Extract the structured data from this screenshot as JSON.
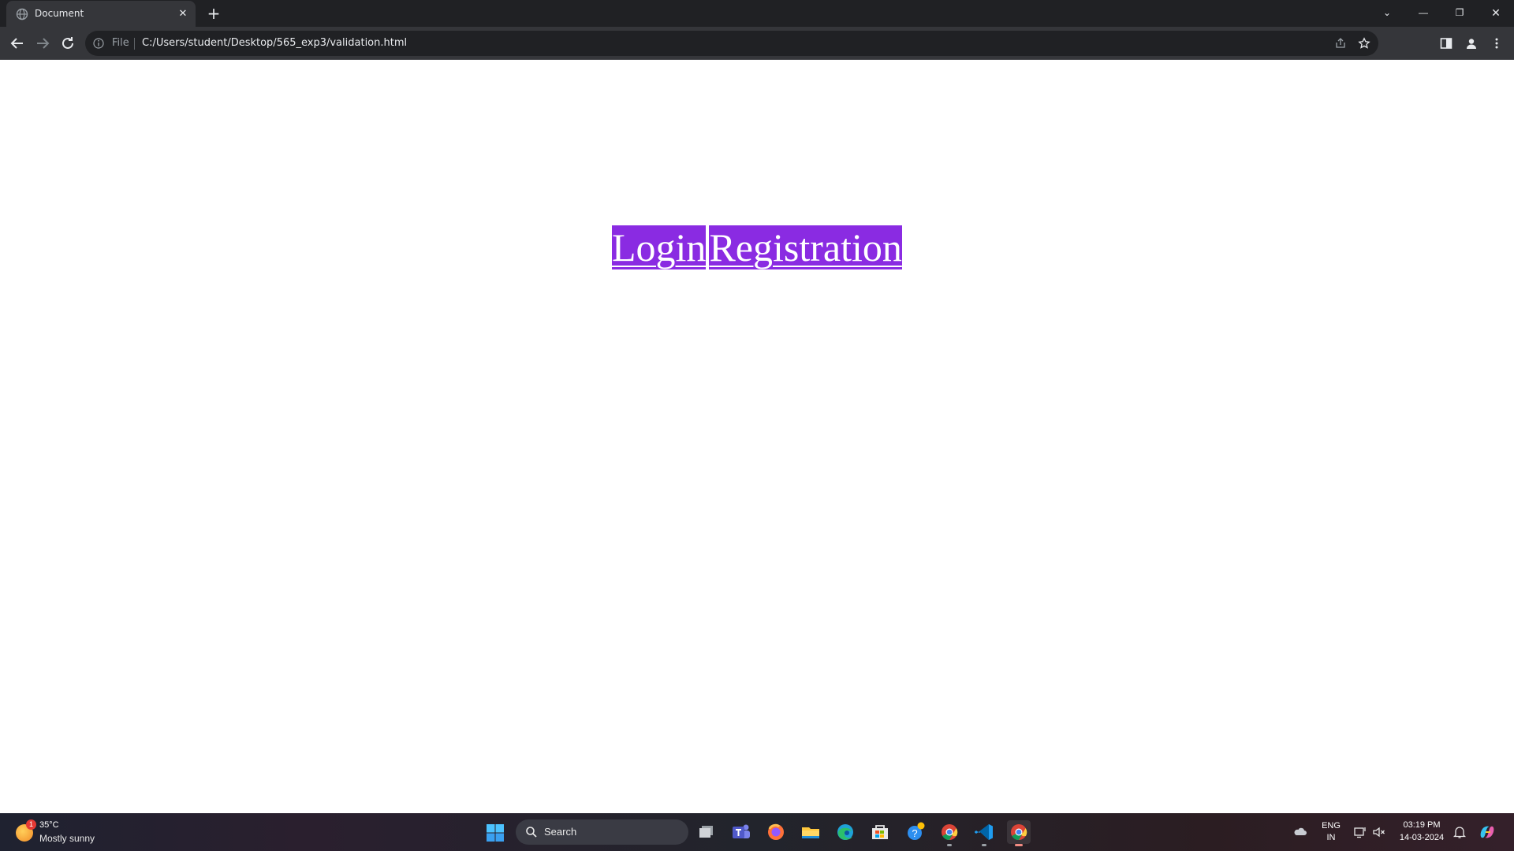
{
  "browser": {
    "tab_title": "Document",
    "tab_close": "✕",
    "new_tab": "+",
    "omnibox_scheme": "File",
    "omnibox_url": "C:/Users/student/Desktop/565_exp3/validation.html",
    "window_controls": {
      "list": "⌄",
      "minimize": "—",
      "restore": "❐",
      "close": "✕"
    }
  },
  "page": {
    "nav_links": [
      "Login",
      "Registration"
    ],
    "link_color": "#8a2be2"
  },
  "taskbar": {
    "weather": {
      "temp": "35°C",
      "desc": "Mostly sunny",
      "badge": "1"
    },
    "search_placeholder": "Search",
    "lang_top": "ENG",
    "lang_bottom": "IN",
    "time": "03:19 PM",
    "date": "14-03-2024",
    "apps": [
      "task-view-icon",
      "teams-icon",
      "firefox-icon",
      "file-explorer-icon",
      "edge-icon",
      "microsoft-store-icon",
      "help-icon",
      "chrome-icon",
      "vscode-icon",
      "chrome-active-icon"
    ]
  }
}
